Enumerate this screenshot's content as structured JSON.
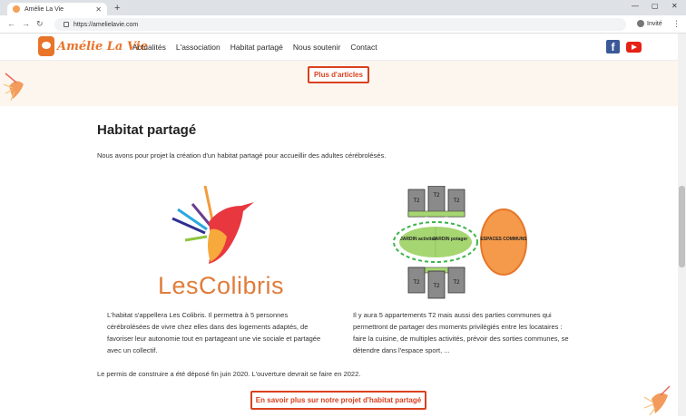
{
  "browser": {
    "tab_title": "Amélie La Vie",
    "url": "https://amelielavie.com",
    "profile_label": "Invité"
  },
  "header": {
    "logo_text": "Amélie La Vie",
    "nav": [
      "Actualités",
      "L'association",
      "Habitat partagé",
      "Nous soutenir",
      "Contact"
    ]
  },
  "band": {
    "button_label": "Plus d'articles"
  },
  "section": {
    "title": "Habitat partagé",
    "intro": "Nous avons pour projet la création d'un habitat partagé pour accueillir des adultes cérébrolésés.",
    "logo_text": "LesColibris",
    "left_text": "L'habitat s'appellera Les Colibris. Il permettra à 5 personnes cérébrolésées de vivre chez elles dans des logements adaptés, de favoriser leur autonomie tout en partageant une vie sociale et partagée avec un collectif.",
    "right_text": "Il y aura 5 appartements T2 mais aussi des parties communes qui permettront de partager des moments privilégiés entre les locataires : faire la cuisine, de multiples activités, prévoir des sorties communes, se détendre dans l'espace sport, ...",
    "permis": "Le permis de construire a été déposé fin juin 2020. L'ouverture devrait se faire en 2022.",
    "cta_label": "En savoir plus sur notre projet d'habitat partagé"
  },
  "diagram": {
    "t2_label": "T2",
    "jardin_activites": "JARDIN activités",
    "jardin_potager": "JARDIN potager",
    "espaces_communs": "ESPACES COMMUNS"
  },
  "colors": {
    "brand_orange": "#e8742a",
    "button_red": "#d9411e",
    "band_bg": "#fdf6ee",
    "garden_green": "#a6d672",
    "commons_orange": "#f59a4a"
  }
}
